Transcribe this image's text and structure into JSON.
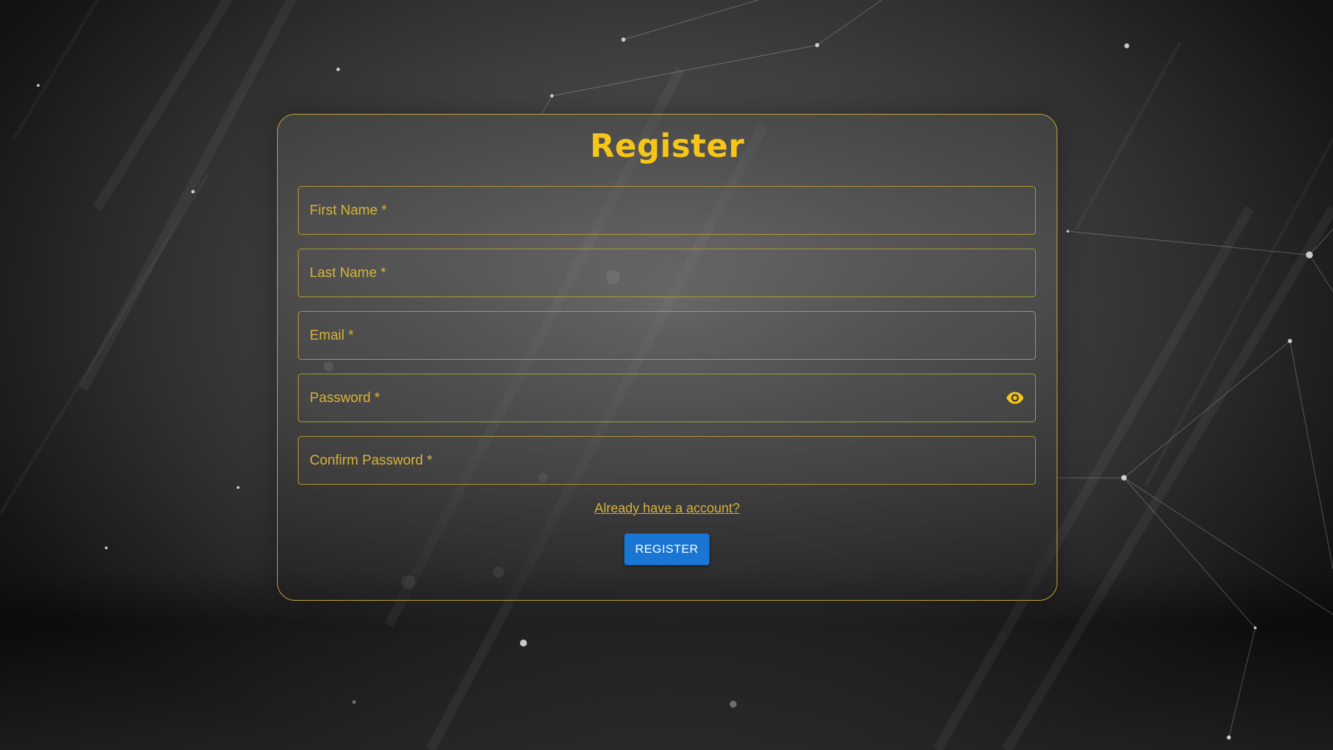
{
  "form": {
    "title": "Register",
    "fields": [
      {
        "label": "First Name *"
      },
      {
        "label": "Last Name *"
      },
      {
        "label": "Email *"
      },
      {
        "label": "Password *",
        "icon": "eye-icon"
      },
      {
        "label": "Confirm Password *"
      }
    ],
    "login_link": "Already have a account?",
    "submit_label": "REGISTER"
  },
  "colors": {
    "accent": "#f5c518",
    "label": "#d7b33a",
    "border": "#b89a2c",
    "button": "#1976d2"
  }
}
